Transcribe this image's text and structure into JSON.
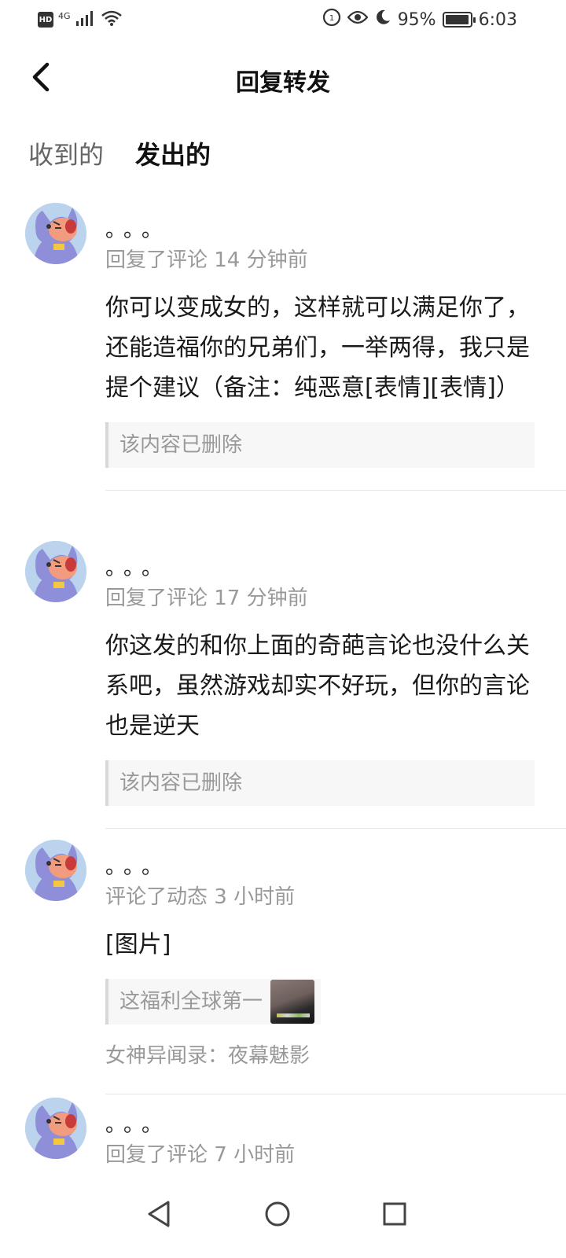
{
  "status_bar": {
    "hd": "HD",
    "network": "4G",
    "battery_percent": "95%",
    "battery_level": 0.95,
    "time": "6:03",
    "icons": [
      "signal-icon",
      "wifi-icon",
      "data-saver-icon",
      "eye-comfort-icon",
      "moon-icon",
      "battery-icon"
    ]
  },
  "header": {
    "title": "回复转发",
    "back_icon": "back-arrow-icon"
  },
  "tabs": [
    {
      "label": "收到的",
      "active": false
    },
    {
      "label": "发出的",
      "active": true
    }
  ],
  "accent_color": "#2fd4b8",
  "items": [
    {
      "username": "。。。",
      "meta": "回复了评论 14 分钟前",
      "content": "你可以变成女的，这样就可以满足你了，还能造福你的兄弟们，一举两得，我只是提个建议（备注：纯恶意[表情][表情]）",
      "quote": "该内容已删除"
    },
    {
      "username": "。。。",
      "meta": "回复了评论 17 分钟前",
      "content": "你这发的和你上面的奇葩言论也没什么关系吧，虽然游戏却实不好玩，但你的言论也是逆天",
      "quote": "该内容已删除"
    },
    {
      "username": "。。。",
      "meta": "评论了动态 3 小时前",
      "content": "[图片]",
      "quote": "这福利全球第一",
      "source": "女神异闻录：夜幕魅影"
    },
    {
      "username": "。。。",
      "meta": "回复了评论 7 小时前"
    }
  ],
  "nav_bar": {
    "icons": [
      "nav-back-icon",
      "nav-home-icon",
      "nav-recents-icon"
    ]
  }
}
